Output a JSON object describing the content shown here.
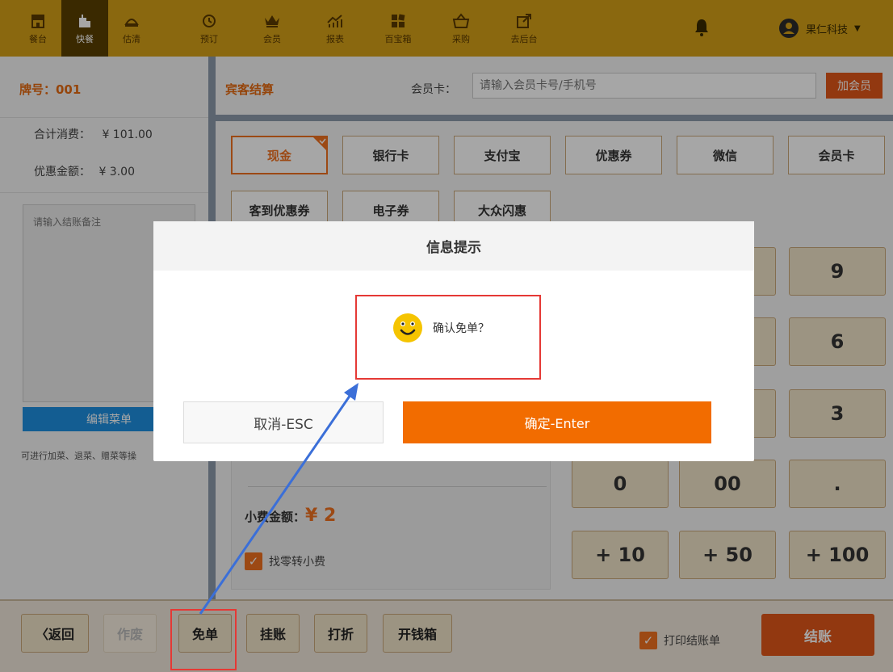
{
  "nav": {
    "left": [
      {
        "label": "餐台",
        "icon": "store-icon"
      },
      {
        "label": "快餐",
        "icon": "fastfood-icon"
      },
      {
        "label": "估清",
        "icon": "bell-dish-icon"
      }
    ],
    "mid": [
      {
        "label": "预订",
        "icon": "clock-icon"
      },
      {
        "label": "会员",
        "icon": "crown-icon"
      },
      {
        "label": "报表",
        "icon": "chart-icon"
      },
      {
        "label": "百宝箱",
        "icon": "grid-icon"
      },
      {
        "label": "采购",
        "icon": "basket-icon"
      },
      {
        "label": "去后台",
        "icon": "external-link-icon"
      }
    ],
    "user": "果仁科技"
  },
  "left": {
    "table_no": "牌号：001",
    "total_label": "合计消费：",
    "total_value": "¥ 101.00",
    "discount_label": "优惠金额：",
    "discount_value": "¥ 3.00",
    "remark_placeholder": "请输入结账备注",
    "edit_menu": "编辑菜单",
    "hint": "可进行加菜、退菜、赠菜等操"
  },
  "right": {
    "title": "宾客结算",
    "member_label": "会员卡：",
    "member_placeholder": "请输入会员卡号/手机号",
    "add_member": "加会员",
    "pay_methods": [
      "现金",
      "银行卡",
      "支付宝",
      "优惠券",
      "微信",
      "会员卡",
      "客到优惠券",
      "电子券",
      "大众闪惠"
    ],
    "tip_label": "小费金额：",
    "tip_value": "¥ 2",
    "change_to_tip": "找零转小费"
  },
  "keypad": {
    "right_col": [
      "9",
      "6",
      "3"
    ],
    "row4": [
      "0",
      "00",
      "."
    ],
    "row5": [
      "+ 10",
      "+ 50",
      "+ 100"
    ]
  },
  "bottom": {
    "back": "〈返回",
    "void": "作废",
    "free": "免单",
    "credit": "挂账",
    "discount": "打折",
    "cashbox": "开钱箱",
    "print_receipt": "打印结账单",
    "checkout": "结账"
  },
  "dialog": {
    "title": "信息提示",
    "message": "确认免单？",
    "cancel": "取消-ESC",
    "confirm": "确定-Enter"
  },
  "colors": {
    "nav_bg": "#d4a017",
    "accent": "#f26c00",
    "tan": "#f0e3c8",
    "annotation": "#e53935",
    "arrow": "#3b6fd8"
  }
}
